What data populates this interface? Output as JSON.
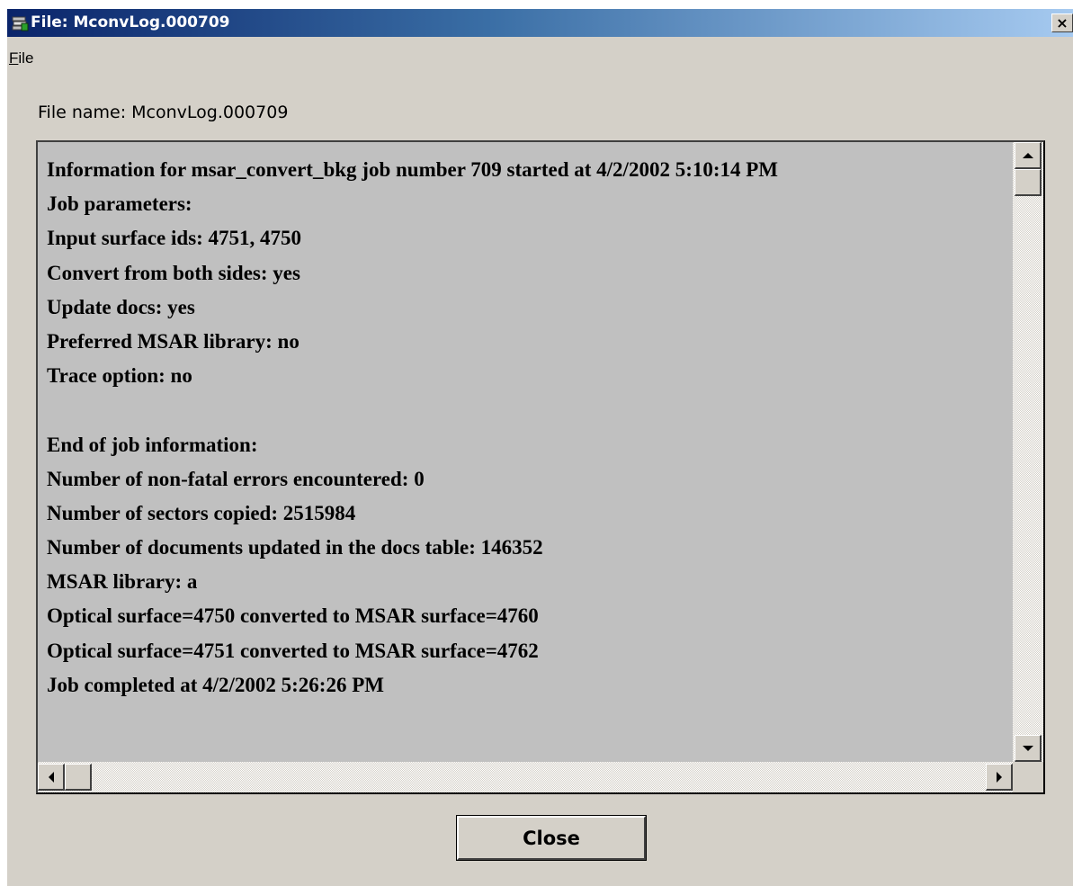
{
  "window": {
    "title": "File: MconvLog.000709",
    "close_glyph": "×"
  },
  "menu": {
    "file": "File"
  },
  "file_name_label": "File name: MconvLog.000709",
  "log_lines": [
    "Information for msar_convert_bkg job number 709 started at 4/2/2002 5:10:14 PM",
    "Job parameters:",
    "Input surface ids: 4751, 4750",
    "Convert from both sides: yes",
    "Update docs: yes",
    "Preferred MSAR library: no",
    "Trace option: no",
    "",
    "End of job information:",
    "Number of non-fatal errors encountered: 0",
    "Number of sectors copied: 2515984",
    "Number of documents updated in the docs table: 146352",
    "MSAR library: a",
    "Optical surface=4750 converted to MSAR surface=4760",
    "Optical surface=4751 converted to MSAR surface=4762",
    "Job completed at 4/2/2002 5:26:26 PM"
  ],
  "buttons": {
    "close": "Close"
  },
  "colors": {
    "title_start": "#0a246a",
    "title_end": "#a6caf0",
    "face": "#d4d0c8",
    "text_bg": "#c0c0c0"
  },
  "icons": {
    "app": "app-icon",
    "close": "close-icon"
  }
}
